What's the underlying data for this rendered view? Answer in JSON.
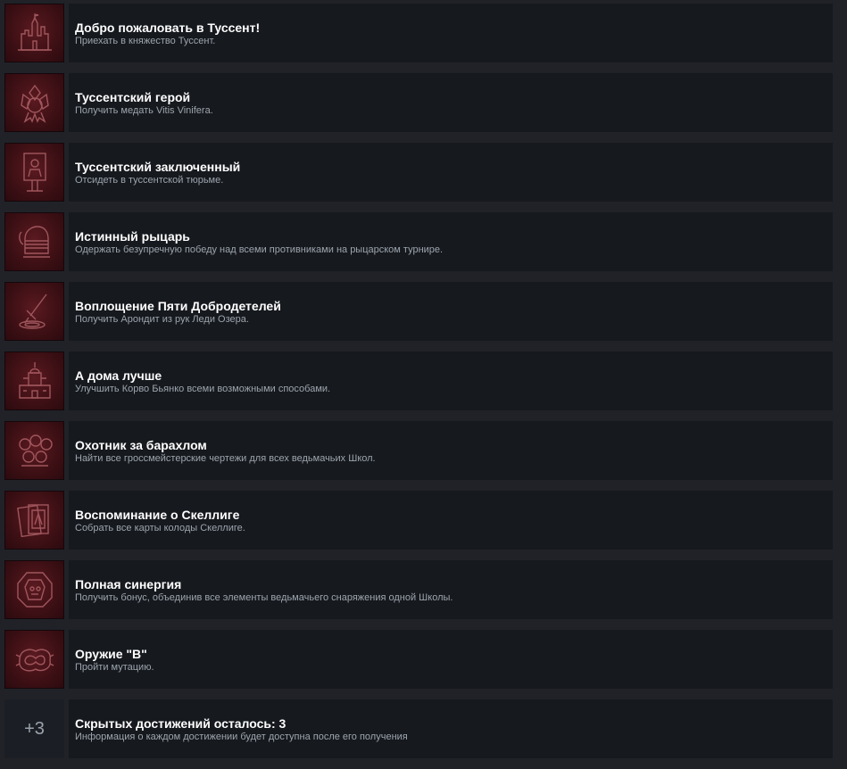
{
  "achievements": [
    {
      "icon": "castle-icon",
      "title": "Добро пожаловать в Туссент!",
      "desc": "Приехать в княжество Туссент."
    },
    {
      "icon": "medal-icon",
      "title": "Туссентский герой",
      "desc": "Получить медать Vitis Vinifera."
    },
    {
      "icon": "prisoner-icon",
      "title": "Туссентский заключенный",
      "desc": "Отсидеть в туссентской тюрьме."
    },
    {
      "icon": "knight-helmet-icon",
      "title": "Истинный рыцарь",
      "desc": "Одержать безупречную победу над всеми противниками на рыцарском турнире."
    },
    {
      "icon": "sword-in-lake-icon",
      "title": "Воплощение Пяти Добродетелей",
      "desc": "Получить Арондит из рук Леди Озера."
    },
    {
      "icon": "villa-icon",
      "title": "А дома лучше",
      "desc": "Улучшить Корво Бьянко всеми возможными способами."
    },
    {
      "icon": "scrolls-icon",
      "title": "Охотник за барахлом",
      "desc": "Найти все гроссмейстерские чертежи для всех ведьмачьих Школ."
    },
    {
      "icon": "cards-icon",
      "title": "Воспоминание о Скеллиге",
      "desc": "Собрать все карты колоды Скеллиге."
    },
    {
      "icon": "witcher-gear-icon",
      "title": "Полная синергия",
      "desc": "Получить бонус, объединив все элементы ведьмачьего снаряжения одной Школы."
    },
    {
      "icon": "mutation-icon",
      "title": "Оружие \"В\"",
      "desc": "Пройти мутацию."
    }
  ],
  "hidden": {
    "count_label": "+3",
    "title": "Скрытых достижений осталось: 3",
    "desc": "Информация о каждом достижении будет доступна после его получения"
  },
  "colors": {
    "icon_bg": "#4a1419",
    "row_bg": "#16191e",
    "page_bg": "#202228",
    "title": "#ffffff",
    "desc": "#9da5ae"
  }
}
